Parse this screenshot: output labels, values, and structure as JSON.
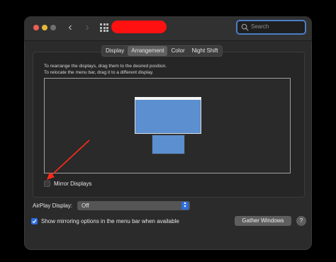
{
  "titlebar": {
    "search_placeholder": "Search",
    "back_glyph": "‹",
    "forward_glyph": "›",
    "icons": [
      "grid-icon",
      "search-icon"
    ]
  },
  "tabs": [
    {
      "label": "Display",
      "active": false
    },
    {
      "label": "Arrangement",
      "active": true
    },
    {
      "label": "Color",
      "active": false
    },
    {
      "label": "Night Shift",
      "active": false
    }
  ],
  "arrangement": {
    "instruction_line1": "To rearrange the displays, drag them to the desired position.",
    "instruction_line2": "To relocate the menu bar, drag it to a different display.",
    "mirror_label": "Mirror Displays",
    "mirror_checked": false
  },
  "airplay": {
    "label": "AirPlay Display:",
    "value": "Off",
    "stepper_glyph": "⌃⌄"
  },
  "mirroring_option": {
    "label": "Show mirroring options in the menu bar when available",
    "checked": true
  },
  "buttons": {
    "gather": "Gather Windows",
    "help": "?"
  },
  "colors": {
    "accent": "#2d6ee0",
    "display": "#5b8fcf",
    "annotation_arrow": "#ff2a1a",
    "redaction": "#ff1111"
  }
}
